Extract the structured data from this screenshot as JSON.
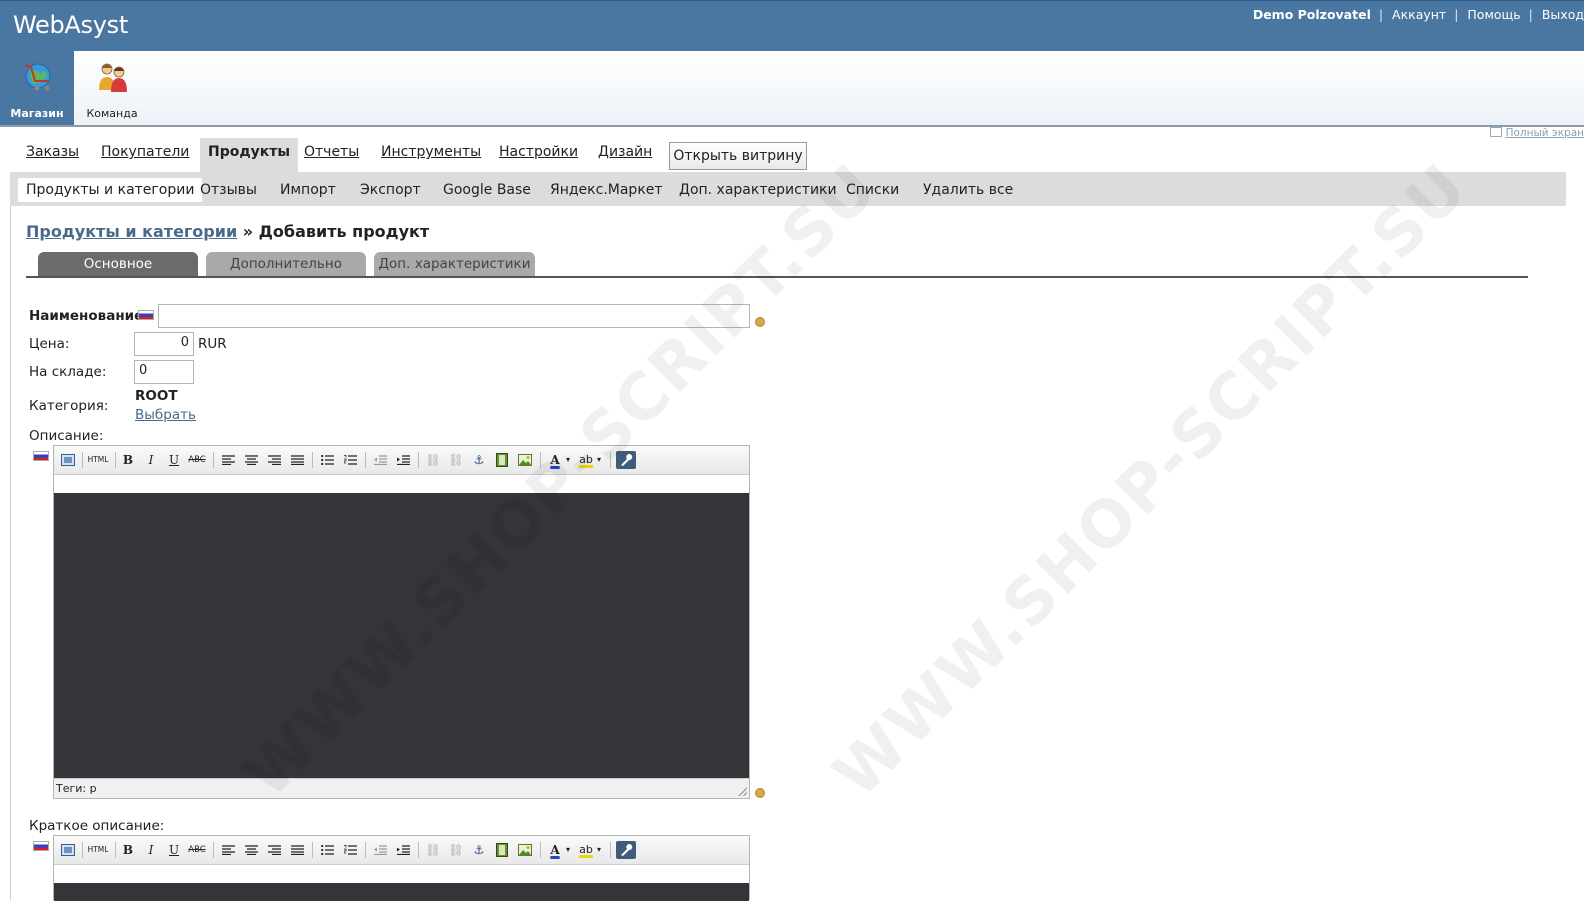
{
  "header": {
    "logo": "WebAsyst",
    "user_name": "Demo Polzovatel",
    "links": [
      "Аккаунт",
      "Помощь",
      "Выход"
    ],
    "separator": "|"
  },
  "apps": [
    {
      "label": "Магазин",
      "active": true
    },
    {
      "label": "Команда",
      "active": false
    }
  ],
  "fullscreen_label": "Полный экран",
  "main_tabs": [
    "Заказы",
    "Покупатели",
    "Продукты",
    "Отчеты",
    "Инструменты",
    "Настройки",
    "Дизайн"
  ],
  "main_tab_active": "Продукты",
  "open_shop_button": "Открыть витрину",
  "sub_tabs": [
    "Продукты и категории",
    "Отзывы",
    "Импорт",
    "Экспорт",
    "Google Base",
    "Яндекс.Маркет",
    "Доп. характеристики",
    "Списки",
    "Удалить все"
  ],
  "sub_tab_active": "Продукты и категории",
  "breadcrumb": {
    "link": "Продукты и категории",
    "separator": "»",
    "current": "Добавить продукт"
  },
  "edit_tabs": [
    "Основное",
    "Дополнительно",
    "Доп. характеристики"
  ],
  "edit_tab_active": "Основное",
  "form": {
    "name_label": "Наименование:",
    "name_value": "",
    "price_label": "Цена:",
    "price_value": "0",
    "currency": "RUR",
    "stock_label": "На складе:",
    "stock_value": "0",
    "category_label": "Категория:",
    "category_value": "ROOT",
    "category_choose": "Выбрать",
    "description_label": "Описание:",
    "description_tags": "Теги: p",
    "short_description_label": "Краткое описание:"
  },
  "toolbar": {
    "html": "HTML",
    "bold": "B",
    "italic": "I",
    "underline": "U",
    "strike": "ABC",
    "font_color": "A",
    "highlight": "ab"
  },
  "watermark": "WWW.SHOP-SCRIPT.SU",
  "colors": {
    "header_bg": "#4a76a2",
    "editor_bg": "#343538",
    "tab_active": "#6b6b6b",
    "tab_inactive": "#a9a9a9"
  }
}
